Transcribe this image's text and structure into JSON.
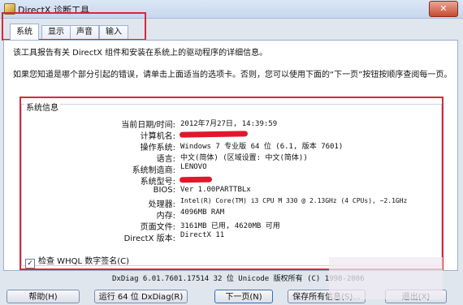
{
  "window": {
    "title": "DirectX 诊断工具",
    "close": "✕"
  },
  "tabs": [
    "系统",
    "显示",
    "声音",
    "输入"
  ],
  "intro": {
    "line1": "该工具报告有关 DirectX 组件和安装在系统上的驱动程序的详细信息。",
    "line2": "如果您知道是哪个部分引起的错误，请单击上面适当的选项卡。否则，您可以使用下面的“下一页”按钮按顺序查阅每一页。"
  },
  "system_info": {
    "group_label": "系统信息",
    "rows": [
      {
        "key": "当前日期/时间:",
        "value": "2012年7月27日, 14:39:59"
      },
      {
        "key": "计算机名:",
        "value": ""
      },
      {
        "key": "操作系统:",
        "value": "Windows 7 专业版 64 位 (6.1, 版本 7601)"
      },
      {
        "key": "语言:",
        "value": "中文(简体) (区域设置: 中文(简体))"
      },
      {
        "key": "系统制造商:",
        "value": "LENOVO"
      },
      {
        "key": "系统型号:",
        "value": ""
      },
      {
        "key": "BIOS:",
        "value": "Ver 1.00PARTTBLx"
      },
      {
        "key": "处理器:",
        "value": "Intel(R) Core(TM) i3 CPU       M 330  @ 2.13GHz (4 CPUs), ~2.1GHz"
      },
      {
        "key": "内存:",
        "value": "4096MB RAM"
      },
      {
        "key": "页面文件:",
        "value": "3161MB 已用, 4620MB 可用"
      },
      {
        "key": "DirectX 版本:",
        "value": "DirectX 11"
      }
    ]
  },
  "whql": {
    "checked": true,
    "label": "检查 WHQL 数字签名(C)"
  },
  "footer": "DxDiag 6.01.7601.17514 32 位 Unicode 版权所有 (C) 1998-2006",
  "buttons": {
    "help": "帮助(H)",
    "run64": "运行 64 位 DxDiag(R)",
    "next": "下一页(N)",
    "save": "保存所有信息(S)...",
    "exit": "退出(X)"
  },
  "colors": {
    "highlight": "#d7283a",
    "redaction": "#e0182b",
    "window_bg": "#dfe6ee"
  }
}
